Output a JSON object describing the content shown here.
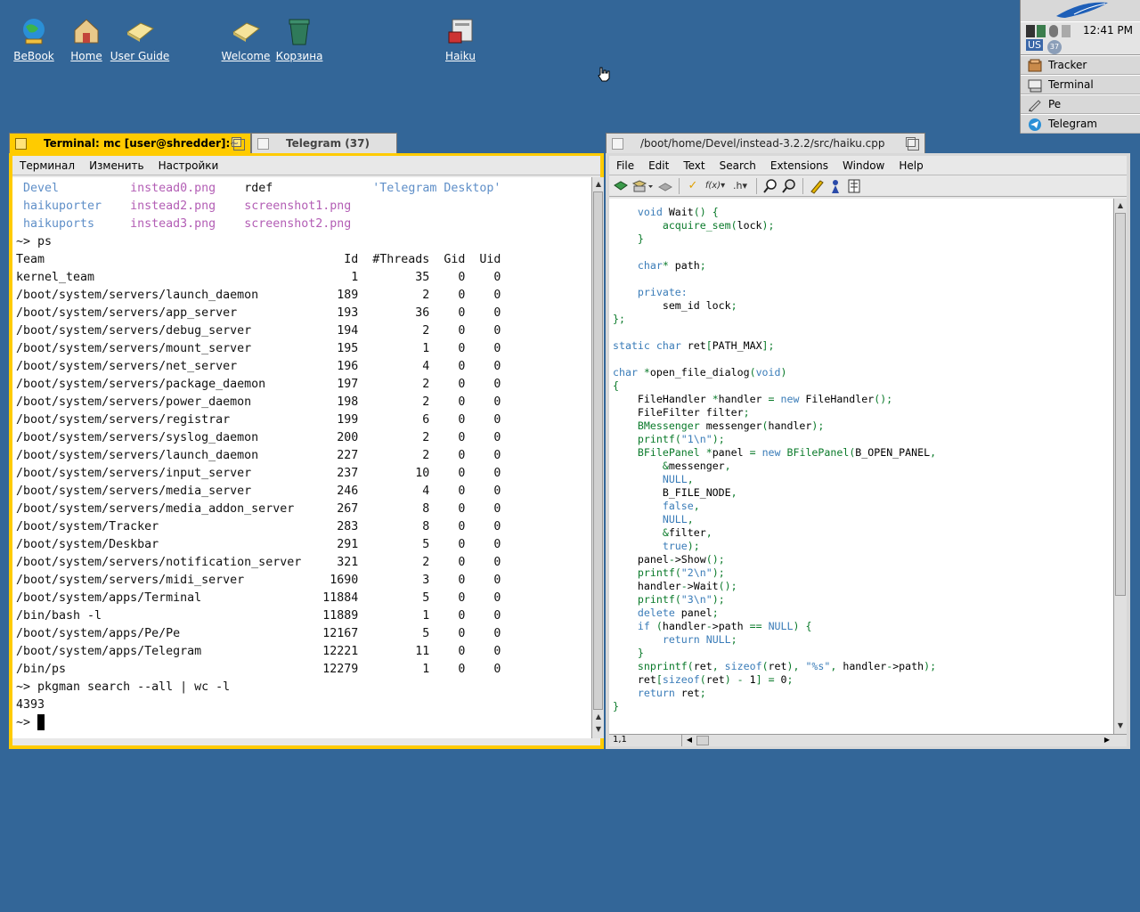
{
  "desktop": {
    "icons": [
      {
        "label": "BeBook",
        "icon": "bebook-globe-icon"
      },
      {
        "label": "Home",
        "icon": "home-icon"
      },
      {
        "label": "User Guide",
        "icon": "user-guide-icon"
      },
      {
        "label": "Welcome",
        "icon": "welcome-icon"
      },
      {
        "label": "Корзина",
        "icon": "trash-icon"
      },
      {
        "label": "Haiku",
        "icon": "haiku-volume-icon"
      }
    ]
  },
  "deskbar": {
    "clock": "12:41 PM",
    "keyboard": "US",
    "badge": "37",
    "apps": [
      {
        "label": "Tracker",
        "icon": "tracker-icon"
      },
      {
        "label": "Terminal",
        "icon": "terminal-icon"
      },
      {
        "label": "Pe",
        "icon": "pe-icon"
      },
      {
        "label": "Telegram",
        "icon": "telegram-icon"
      }
    ]
  },
  "terminal": {
    "tab_title": "Terminal: mc [user@shredder]:~",
    "second_tab_title": "Telegram (37)",
    "menu": [
      "Терминал",
      "Изменить",
      "Настройки"
    ],
    "ls_rows": [
      [
        {
          "text": "Devel",
          "kind": "dir"
        },
        {
          "text": "instead0.png",
          "kind": "img"
        },
        {
          "text": "rdef",
          "kind": "plain"
        },
        {
          "text": "'Telegram Desktop'",
          "kind": "str"
        }
      ],
      [
        {
          "text": "haikuporter",
          "kind": "dir"
        },
        {
          "text": "instead2.png",
          "kind": "img"
        },
        {
          "text": "screenshot1.png",
          "kind": "img"
        },
        {
          "text": "",
          "kind": "plain"
        }
      ],
      [
        {
          "text": "haikuports",
          "kind": "dir"
        },
        {
          "text": "instead3.png",
          "kind": "img"
        },
        {
          "text": "screenshot2.png",
          "kind": "img"
        },
        {
          "text": "",
          "kind": "plain"
        }
      ]
    ],
    "cmd_ps": "~> ps",
    "ps_header": [
      "Team",
      "Id",
      "#Threads",
      "Gid",
      "Uid"
    ],
    "ps_rows": [
      [
        "kernel_team",
        "1",
        "35",
        "0",
        "0"
      ],
      [
        "/boot/system/servers/launch_daemon",
        "189",
        "2",
        "0",
        "0"
      ],
      [
        "/boot/system/servers/app_server",
        "193",
        "36",
        "0",
        "0"
      ],
      [
        "/boot/system/servers/debug_server",
        "194",
        "2",
        "0",
        "0"
      ],
      [
        "/boot/system/servers/mount_server",
        "195",
        "1",
        "0",
        "0"
      ],
      [
        "/boot/system/servers/net_server",
        "196",
        "4",
        "0",
        "0"
      ],
      [
        "/boot/system/servers/package_daemon",
        "197",
        "2",
        "0",
        "0"
      ],
      [
        "/boot/system/servers/power_daemon",
        "198",
        "2",
        "0",
        "0"
      ],
      [
        "/boot/system/servers/registrar",
        "199",
        "6",
        "0",
        "0"
      ],
      [
        "/boot/system/servers/syslog_daemon",
        "200",
        "2",
        "0",
        "0"
      ],
      [
        "/boot/system/servers/launch_daemon",
        "227",
        "2",
        "0",
        "0"
      ],
      [
        "/boot/system/servers/input_server",
        "237",
        "10",
        "0",
        "0"
      ],
      [
        "/boot/system/servers/media_server",
        "246",
        "4",
        "0",
        "0"
      ],
      [
        "/boot/system/servers/media_addon_server",
        "267",
        "8",
        "0",
        "0"
      ],
      [
        "/boot/system/Tracker",
        "283",
        "8",
        "0",
        "0"
      ],
      [
        "/boot/system/Deskbar",
        "291",
        "5",
        "0",
        "0"
      ],
      [
        "/boot/system/servers/notification_server",
        "321",
        "2",
        "0",
        "0"
      ],
      [
        "/boot/system/servers/midi_server",
        "1690",
        "3",
        "0",
        "0"
      ],
      [
        "/boot/system/apps/Terminal",
        "11884",
        "5",
        "0",
        "0"
      ],
      [
        "/bin/bash -l",
        "11889",
        "1",
        "0",
        "0"
      ],
      [
        "/boot/system/apps/Pe/Pe",
        "12167",
        "5",
        "0",
        "0"
      ],
      [
        "/boot/system/apps/Telegram",
        "12221",
        "11",
        "0",
        "0"
      ],
      [
        "/bin/ps",
        "12279",
        "1",
        "0",
        "0"
      ]
    ],
    "cmd_pkgman": "~> pkgman search --all | wc -l",
    "pkgman_result": "4393",
    "prompt": "~> "
  },
  "pe": {
    "tab_title": "/boot/home/Devel/instead-3.2.2/src/haiku.cpp",
    "menu": [
      "File",
      "Edit",
      "Text",
      "Search",
      "Extensions",
      "Window",
      "Help"
    ],
    "toolbar": [
      {
        "icon": "open-icon"
      },
      {
        "icon": "save-icon"
      },
      {
        "icon": "print-icon"
      },
      {
        "icon": "check-icon"
      },
      {
        "icon": "function-menu-icon"
      },
      {
        "icon": "header-menu-icon"
      },
      {
        "icon": "find-icon"
      },
      {
        "icon": "find-next-icon"
      },
      {
        "icon": "edit-icon"
      },
      {
        "icon": "info-icon"
      },
      {
        "icon": "split-icon"
      }
    ],
    "function_label": "f(x)",
    "header_label": ".h",
    "position": "1,1",
    "code": [
      "    void Wait() {",
      "        acquire_sem(lock);",
      "    }",
      "",
      "    char* path;",
      "",
      "    private:",
      "        sem_id lock;",
      "};",
      "",
      "static char ret[PATH_MAX];",
      "",
      "char *open_file_dialog(void)",
      "{",
      "    FileHandler *handler = new FileHandler();",
      "    FileFilter filter;",
      "    BMessenger messenger(handler);",
      "    printf(\"1\\n\");",
      "    BFilePanel *panel = new BFilePanel(B_OPEN_PANEL,",
      "        &messenger,",
      "        NULL,",
      "        B_FILE_NODE,",
      "        false,",
      "        NULL,",
      "        &filter,",
      "        true);",
      "    panel->Show();",
      "    printf(\"2\\n\");",
      "    handler->Wait();",
      "    printf(\"3\\n\");",
      "    delete panel;",
      "    if (handler->path == NULL) {",
      "        return NULL;",
      "    }",
      "    snprintf(ret, sizeof(ret), \"%s\", handler->path);",
      "    ret[sizeof(ret) - 1] = 0;",
      "    return ret;",
      "}"
    ]
  },
  "colors": {
    "desktop": "#336698",
    "active_tab": "#ffcb00",
    "inactive_tab": "#e0e0e0",
    "dir": "#5f8fc8",
    "image_file": "#b35eb5"
  }
}
